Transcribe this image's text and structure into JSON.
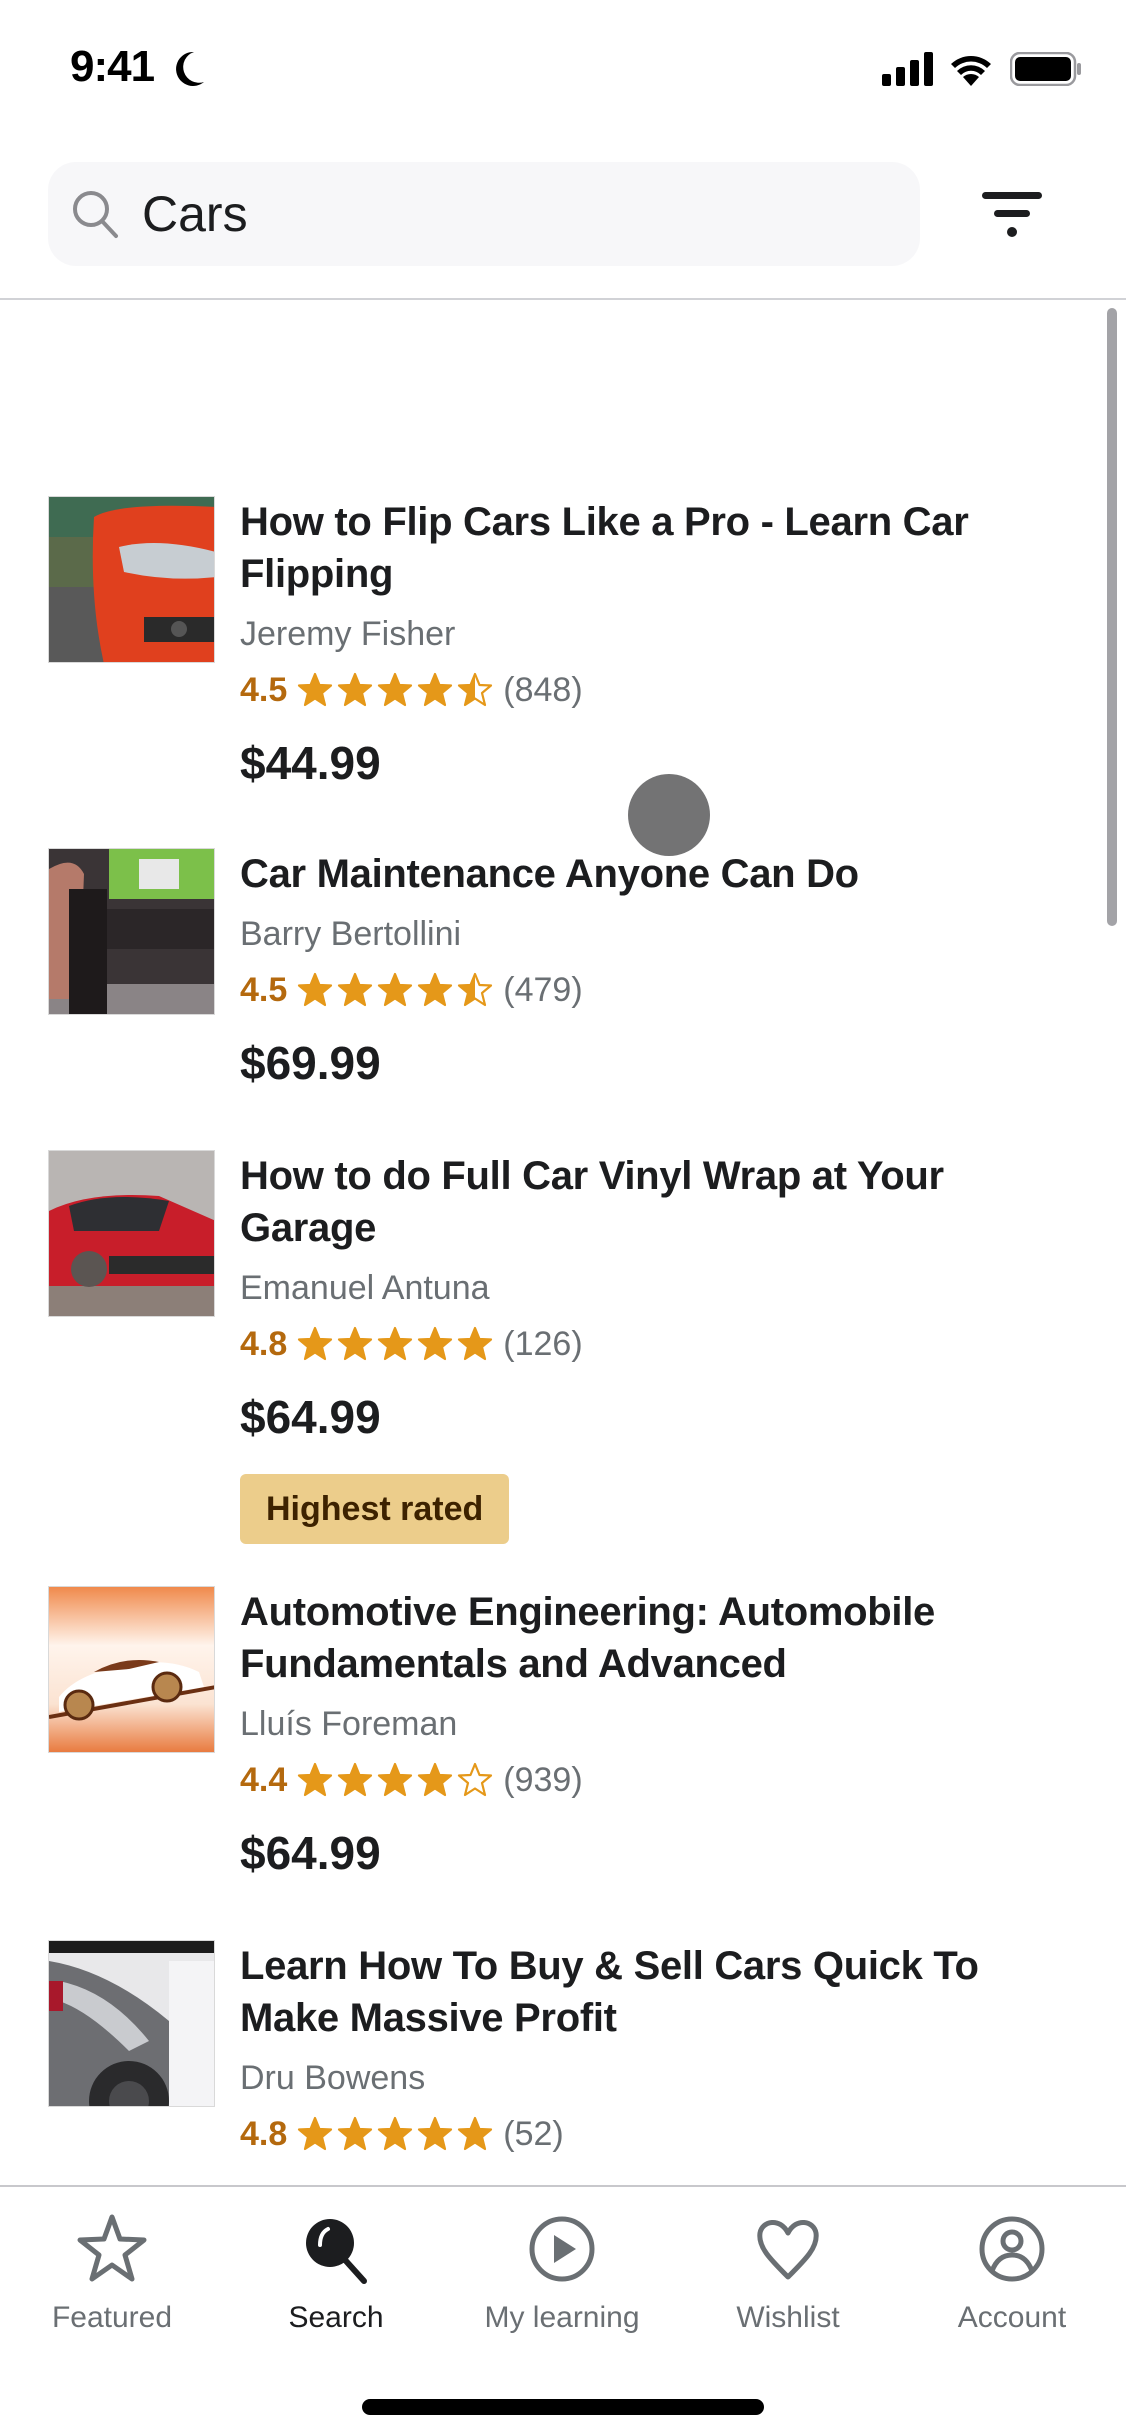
{
  "status_bar": {
    "time": "9:41",
    "icons": [
      "moon-icon",
      "cellular-signal-icon",
      "wifi-icon",
      "battery-icon"
    ]
  },
  "search": {
    "query": "Cars",
    "icon": "search-icon",
    "filter_icon": "filter-icon"
  },
  "courses": [
    {
      "title": "How to Flip Cars Like a Pro - Learn Car Flipping",
      "instructor": "Jeremy Fisher",
      "rating": "4.5",
      "stars": 4.5,
      "reviews": "(848)",
      "price": "$44.99"
    },
    {
      "title": "Car Maintenance Anyone Can Do",
      "instructor": "Barry Bertollini",
      "rating": "4.5",
      "stars": 4.5,
      "reviews": "(479)",
      "price": "$69.99"
    },
    {
      "title": "How to do Full Car Vinyl Wrap at Your Garage",
      "instructor": "Emanuel Antuna",
      "rating": "4.8",
      "stars": 5,
      "reviews": "(126)",
      "price": "$64.99",
      "badge": "Highest rated"
    },
    {
      "title": "Automotive Engineering: Automobile Fundamentals and Advanced",
      "instructor": "Lluís Foreman",
      "rating": "4.4",
      "stars": 4,
      "reviews": "(939)",
      "price": "$64.99"
    },
    {
      "title": "Learn How To Buy & Sell Cars Quick To Make Massive Profit",
      "instructor": "Dru Bowens",
      "rating": "4.8",
      "stars": 5,
      "reviews": "(52)",
      "price": ""
    }
  ],
  "tab_bar": {
    "tabs": [
      {
        "label": "Featured",
        "icon": "star-icon",
        "active": false
      },
      {
        "label": "Search",
        "icon": "search-icon",
        "active": true
      },
      {
        "label": "My learning",
        "icon": "play-circle-icon",
        "active": false
      },
      {
        "label": "Wishlist",
        "icon": "heart-icon",
        "active": false
      },
      {
        "label": "Account",
        "icon": "account-icon",
        "active": false
      }
    ]
  },
  "colors": {
    "rating": "#b4690e",
    "star": "#e59819",
    "badge_bg": "#eccd8b",
    "badge_text": "#3d2200",
    "text_primary": "#1c1d1f",
    "text_secondary": "#6a6f73"
  }
}
